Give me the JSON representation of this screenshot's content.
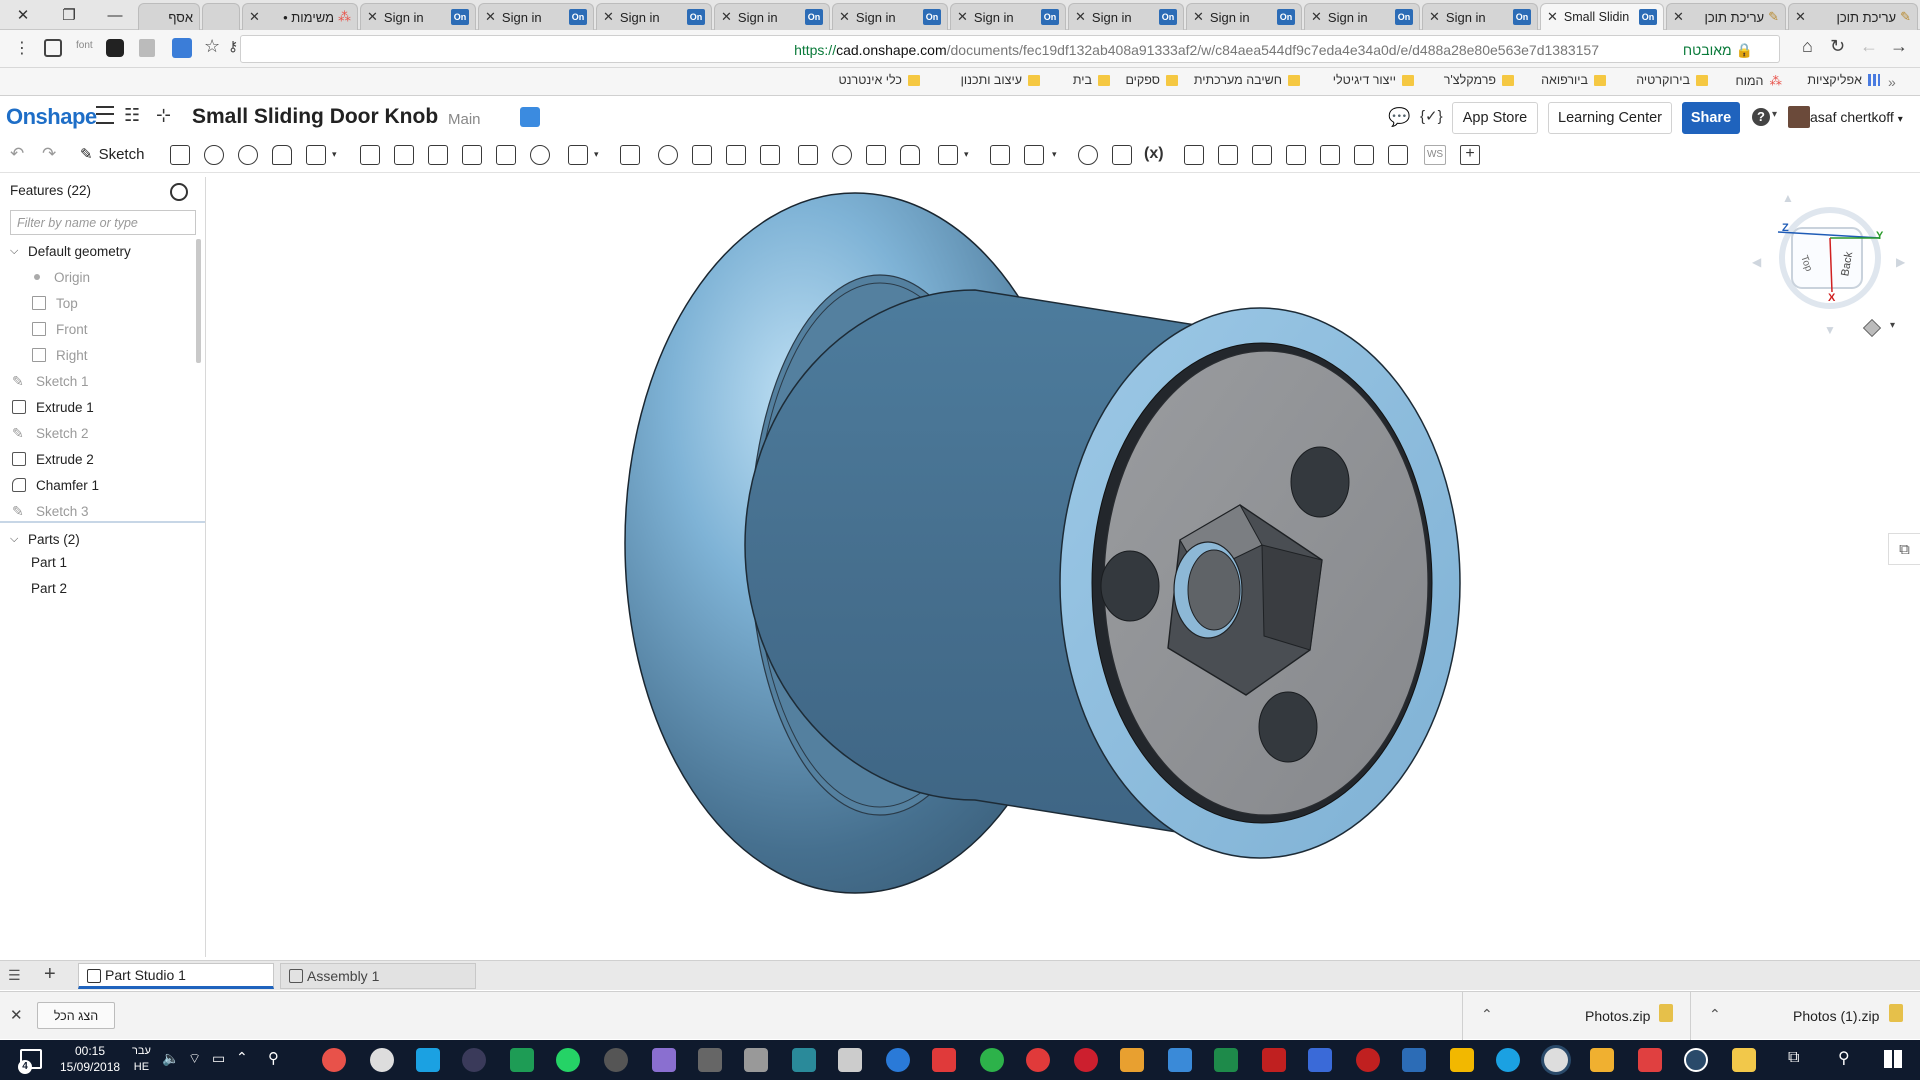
{
  "browser": {
    "tabs": [
      {
        "label": "אסף",
        "favicon": ""
      },
      {
        "label": "",
        "favicon": ""
      },
      {
        "label": "• משימות",
        "favicon": "asana-icon"
      },
      {
        "label": "Sign in",
        "favicon": "On"
      },
      {
        "label": "Sign in",
        "favicon": "On"
      },
      {
        "label": "Sign in",
        "favicon": "On"
      },
      {
        "label": "Sign in",
        "favicon": "On"
      },
      {
        "label": "Sign in",
        "favicon": "On"
      },
      {
        "label": "Sign in",
        "favicon": "On"
      },
      {
        "label": "Sign in",
        "favicon": "On"
      },
      {
        "label": "Sign in",
        "favicon": "On"
      },
      {
        "label": "Sign in",
        "favicon": "On"
      },
      {
        "label": "Sign in",
        "favicon": "On"
      },
      {
        "label": "Small Slidin",
        "favicon": "On",
        "active": true
      },
      {
        "label": "עריכת תוכן",
        "favicon": "edit-icon"
      },
      {
        "label": "עריכת תוכן",
        "favicon": "edit-icon"
      }
    ],
    "url_prefix": "https://",
    "url_domain": "cad.onshape.com",
    "url_path": "/documents/fec19df132ab408a91333af2/w/c84aea544df9c7eda4e34a0d/e/d488a28e80e563e7d1383157",
    "secure_label": "מאובטח",
    "font_ext_label": "font"
  },
  "bookmarks": [
    {
      "label": "אפליקציות",
      "icon": "apps-icon"
    },
    {
      "label": "המוח",
      "icon": "asana-icon"
    },
    {
      "label": "בירוקרטיה",
      "icon": "folder-icon"
    },
    {
      "label": "ביורפואה",
      "icon": "folder-icon"
    },
    {
      "label": "פרמקלצ'ר",
      "icon": "folder-icon"
    },
    {
      "label": "ייצור דיגיטלי",
      "icon": "folder-icon"
    },
    {
      "label": "חשיבה מערכתית",
      "icon": "folder-icon"
    },
    {
      "label": "ספקים",
      "icon": "folder-icon"
    },
    {
      "label": "בית",
      "icon": "folder-icon"
    },
    {
      "label": "עיצוב ותכנון",
      "icon": "folder-icon"
    },
    {
      "label": "כלי אינטרנט",
      "icon": "folder-icon"
    }
  ],
  "header": {
    "logo": "Onshape",
    "document_title": "Small Sliding Door Knob",
    "branch": "Main",
    "app_store": "App Store",
    "learning_center": "Learning Center",
    "share": "Share",
    "user_name": "asaf chertkoff"
  },
  "toolbar": {
    "sketch_label": "Sketch"
  },
  "features": {
    "title": "Features (22)",
    "filter_placeholder": "Filter by name or type",
    "default_geometry": "Default geometry",
    "geometry_items": [
      "Origin",
      "Top",
      "Front",
      "Right"
    ],
    "items": [
      {
        "label": "Sketch 1",
        "type": "sketch"
      },
      {
        "label": "Extrude 1",
        "type": "extrude"
      },
      {
        "label": "Sketch 2",
        "type": "sketch"
      },
      {
        "label": "Extrude 2",
        "type": "extrude"
      },
      {
        "label": "Chamfer 1",
        "type": "chamfer"
      },
      {
        "label": "Sketch 3",
        "type": "sketch"
      }
    ],
    "parts_title": "Parts (2)",
    "parts": [
      "Part 1",
      "Part 2"
    ]
  },
  "viewcube": {
    "z": "Z",
    "y": "Y",
    "x": "X",
    "top": "Top",
    "back": "Back"
  },
  "bottom_tabs": [
    {
      "label": "Part Studio 1",
      "active": true
    },
    {
      "label": "Assembly 1",
      "active": false
    }
  ],
  "downloads": {
    "show_all": "הצג הכל",
    "items": [
      "Photos.zip",
      "Photos (1).zip"
    ]
  },
  "taskbar": {
    "time": "00:15",
    "date": "15/09/2018",
    "lang_top": "עבר",
    "lang": "HE",
    "notification_count": "4"
  },
  "colors": {
    "accent": "#1f63bd",
    "model_light": "#8fc0e0",
    "model_dark": "#3e6c8c",
    "face_gray": "#8a8c90"
  }
}
